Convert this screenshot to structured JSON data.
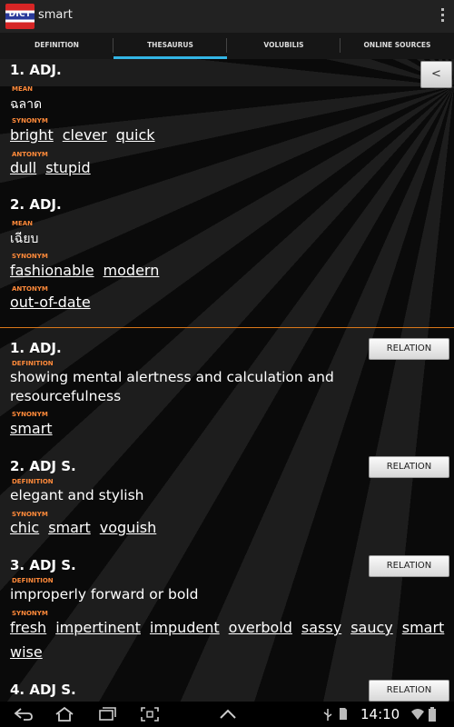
{
  "app": {
    "icon_text": "DICT",
    "title": "smart"
  },
  "tabs": [
    {
      "label": "DEFINITION"
    },
    {
      "label": "THESAURUS"
    },
    {
      "label": "VOLUBILIS"
    },
    {
      "label": "ONLINE SOURCES"
    }
  ],
  "active_tab": "THESAURUS",
  "thesaurus": {
    "collapse_label": "<",
    "entries": [
      {
        "heading": "1. ADJ.",
        "mean_label": "MEAN",
        "mean": "ฉลาด",
        "synonym_label": "SYNONYM",
        "synonyms": [
          "bright",
          "clever",
          "quick"
        ],
        "antonym_label": "ANTONYM",
        "antonyms": [
          "dull",
          "stupid"
        ]
      },
      {
        "heading": "2. ADJ.",
        "mean_label": "MEAN",
        "mean": "เฉียบ",
        "synonym_label": "SYNONYM",
        "synonyms": [
          "fashionable",
          "modern"
        ],
        "antonym_label": "ANTONYM",
        "antonyms": [
          "out-of-date"
        ]
      }
    ]
  },
  "wordnet": {
    "relation_label": "RELATION",
    "entries": [
      {
        "heading": "1. ADJ.",
        "definition_label": "DEFINITION",
        "definition": "showing mental alertness and calculation and resourcefulness",
        "synonym_label": "SYNONYM",
        "synonyms": [
          "smart"
        ]
      },
      {
        "heading": "2. ADJ S.",
        "definition_label": "DEFINITION",
        "definition": "elegant and stylish",
        "synonym_label": "SYNONYM",
        "synonyms": [
          "chic",
          "smart",
          "voguish"
        ]
      },
      {
        "heading": "3. ADJ S.",
        "definition_label": "DEFINITION",
        "definition": "improperly forward or bold",
        "synonym_label": "SYNONYM",
        "synonyms": [
          "fresh",
          "impertinent",
          "impudent",
          "overbold",
          "sassy",
          "saucy",
          "smart",
          "wise"
        ]
      },
      {
        "heading": "4. ADJ S."
      }
    ]
  },
  "status": {
    "time": "14:10"
  },
  "colors": {
    "accent_tab": "#33b5e5",
    "label_orange": "#ff8a3a",
    "divider": "#d9771a"
  }
}
